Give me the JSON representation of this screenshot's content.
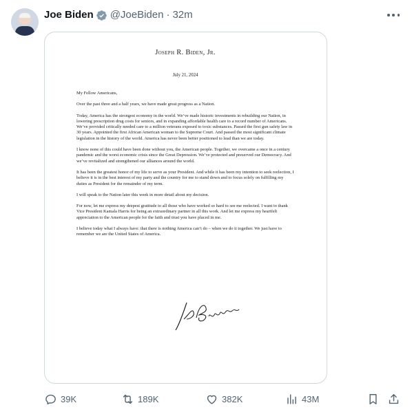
{
  "tweet": {
    "author_name": "Joe Biden",
    "handle": "@JoeBiden",
    "separator": "·",
    "time": "32m",
    "verified_color": "#1d9bf0"
  },
  "letter": {
    "letterhead": "Joseph R. Biden, Jr.",
    "date": "July 21, 2024",
    "greeting": "My Fellow Americans,",
    "paragraphs": [
      "Over the past three and a half years, we have made great progress as a Nation.",
      "Today, America has the strongest economy in the world. We’ve made historic investments in rebuilding our Nation, in lowering prescription drug costs for seniors, and in expanding affordable health care to a record number of Americans. We’ve provided critically needed care to a million veterans exposed to toxic substances. Passed the first gun safety law in 30 years. Appointed the first African American woman to the Supreme Court. And passed the most significant climate legislation in the history of the world. America has never been better positioned to lead than we are today.",
      "I know none of this could have been done without you, the American people. Together, we overcame a once in a century pandemic and the worst economic crisis since the Great Depression. We’ve protected and preserved our Democracy. And we’ve revitalized and strengthened our alliances around the world.",
      "It has been the greatest honor of my life to serve as your President. And while it has been my intention to seek reelection, I believe it is in the best interest of my party and the country for me to stand down and to focus solely on fulfilling my duties as President for the remainder of my term.",
      "I will speak to the Nation later this week in more detail about my decision.",
      "For now, let me express my deepest gratitude to all those who have worked so hard to see me reelected. I want to thank Vice President Kamala Harris for being an extraordinary partner in all this work. And let me express my heartfelt appreciation to the American people for the faith and trust you have placed in me.",
      "I believe today what I always have: that there is nothing America can’t do – when we do it together. We just have to remember we are the United States of America."
    ]
  },
  "actions": {
    "replies": "39K",
    "reposts": "189K",
    "likes": "382K",
    "views": "43M"
  },
  "icons": {
    "reply": "reply-icon",
    "repost": "repost-icon",
    "like": "heart-icon",
    "views": "views-icon",
    "bookmark": "bookmark-icon",
    "share": "share-icon",
    "more": "more-icon"
  }
}
